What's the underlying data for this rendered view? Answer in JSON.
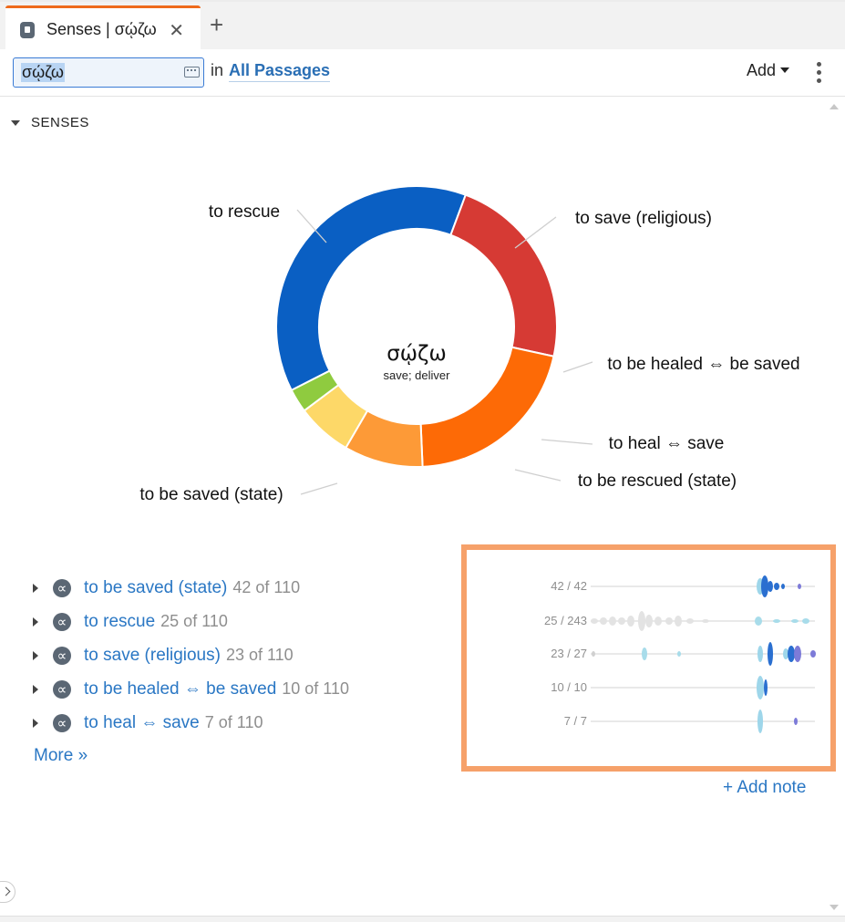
{
  "tab": {
    "title": "Senses | σῴζω",
    "close_icon": "close-icon",
    "add_icon": "plus-icon"
  },
  "toolbar": {
    "search_value": "σῴζω",
    "in_label": "in",
    "scope_label": "All Passages",
    "add_label": "Add"
  },
  "section": {
    "title": "SENSES"
  },
  "donut": {
    "center_word": "σῴζω",
    "center_gloss": "save; deliver"
  },
  "chart_data": {
    "type": "pie",
    "title": "",
    "categories": [
      "to be saved (state)",
      "to rescue",
      "to save (religious)",
      "to be healed ⇔ be saved",
      "to heal ⇔ save",
      "to be rescued (state)"
    ],
    "values": [
      42,
      25,
      23,
      10,
      7,
      3
    ],
    "colors": [
      "#0a5fc3",
      "#d63a34",
      "#fd6a06",
      "#fd9a37",
      "#fdd868",
      "#8fcb3f"
    ]
  },
  "senses": [
    {
      "label": "to be saved (state)",
      "count": "42 of 110"
    },
    {
      "label": "to rescue",
      "count": "25 of 110"
    },
    {
      "label": "to save (religious)",
      "count": "23 of 110"
    },
    {
      "label": "to be healed ⇔ be saved",
      "count": "10 of 110"
    },
    {
      "label": "to heal ⇔ save",
      "count": "7 of 110"
    }
  ],
  "more_label": "More »",
  "distribution": [
    {
      "ratio": "42 / 42"
    },
    {
      "ratio": "25 / 243"
    },
    {
      "ratio": "23 / 27"
    },
    {
      "ratio": "10 / 10"
    },
    {
      "ratio": "7 / 7"
    }
  ],
  "add_note_label": "+ Add note",
  "sense_icon_glyph": "∝"
}
